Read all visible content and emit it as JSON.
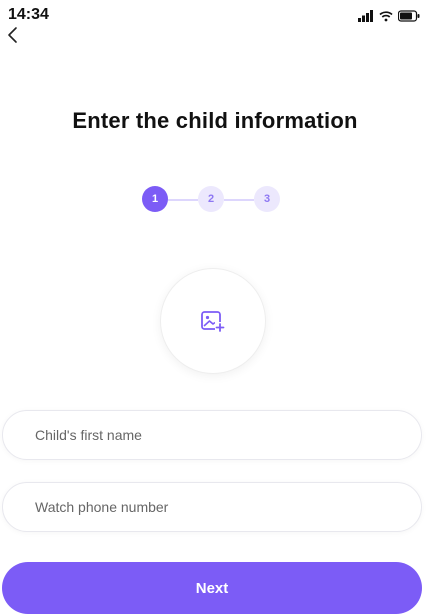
{
  "status_bar": {
    "time": "14:34",
    "icons": [
      "signal-icon",
      "wifi-icon",
      "battery-icon"
    ]
  },
  "header": {
    "back_icon": "chevron-left-icon"
  },
  "page": {
    "title": "Enter the child information"
  },
  "stepper": {
    "steps": [
      {
        "label": "1",
        "active": true
      },
      {
        "label": "2",
        "active": false
      },
      {
        "label": "3",
        "active": false
      }
    ]
  },
  "avatar_upload": {
    "icon": "add-image-icon"
  },
  "form": {
    "first_name": {
      "placeholder": "Child's first name",
      "value": ""
    },
    "phone": {
      "placeholder": "Watch phone number",
      "value": ""
    }
  },
  "actions": {
    "next_label": "Next"
  },
  "colors": {
    "accent": "#7c5cf6",
    "accent_light": "#ece8fd",
    "border": "#e8e8ee"
  }
}
